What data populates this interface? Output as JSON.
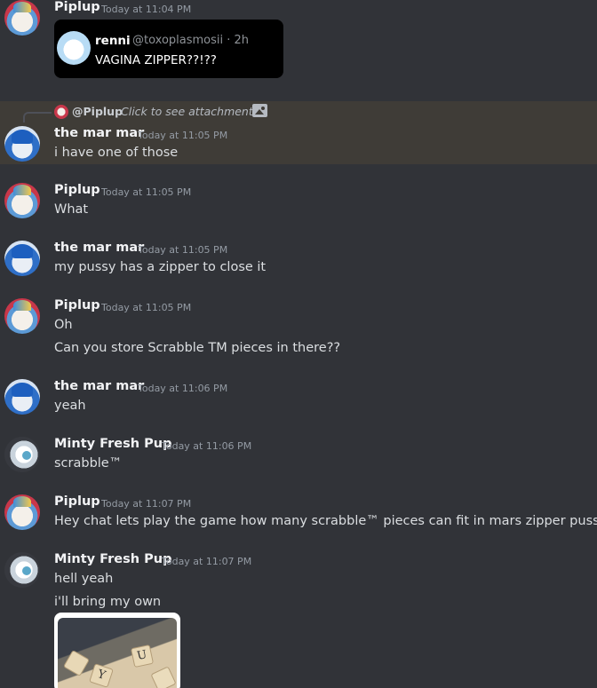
{
  "messages": [
    {
      "author": "Piplup",
      "timestamp": "Today at 11:04 PM",
      "embed": {
        "name": "renni",
        "handle": "@toxoplasmosii · 2h",
        "text": "VAGINA ZIPPER??!??"
      }
    },
    {
      "reply": {
        "author": "@Piplup",
        "attachment_text": "Click to see attachment"
      },
      "author": "the mar mar",
      "timestamp": "Today at 11:05 PM",
      "lines": [
        "i have one of those"
      ],
      "highlighted": true
    },
    {
      "author": "Piplup",
      "timestamp": "Today at 11:05 PM",
      "lines": [
        "What"
      ]
    },
    {
      "author": "the mar mar",
      "timestamp": "Today at 11:05 PM",
      "lines": [
        "my pussy has a zipper to close it"
      ]
    },
    {
      "author": "Piplup",
      "timestamp": "Today at 11:05 PM",
      "lines": [
        "Oh",
        "Can you store Scrabble TM pieces in there??"
      ]
    },
    {
      "author": "the mar mar",
      "timestamp": "Today at 11:06 PM",
      "lines": [
        "yeah"
      ]
    },
    {
      "author": "Minty Fresh Pup",
      "timestamp": "Today at 11:06 PM",
      "lines": [
        "scrabble™"
      ]
    },
    {
      "author": "Piplup",
      "timestamp": "Today at 11:07 PM",
      "lines": [
        "Hey chat lets play the game how many scrabble™ pieces can fit in mars zipper pussy"
      ]
    },
    {
      "author": "Minty Fresh Pup",
      "timestamp": "Today at 11:07 PM",
      "lines": [
        "hell yeah",
        "i'll bring my own"
      ],
      "attachment": {
        "tiles": [
          "U",
          "Y"
        ]
      }
    }
  ],
  "colors": {
    "background": "#313338",
    "highlight": "#3f3c37",
    "username": "#f2f3f5",
    "timestamp": "#949ba4",
    "text": "#dbdee1"
  },
  "icons": [
    "image-icon"
  ]
}
